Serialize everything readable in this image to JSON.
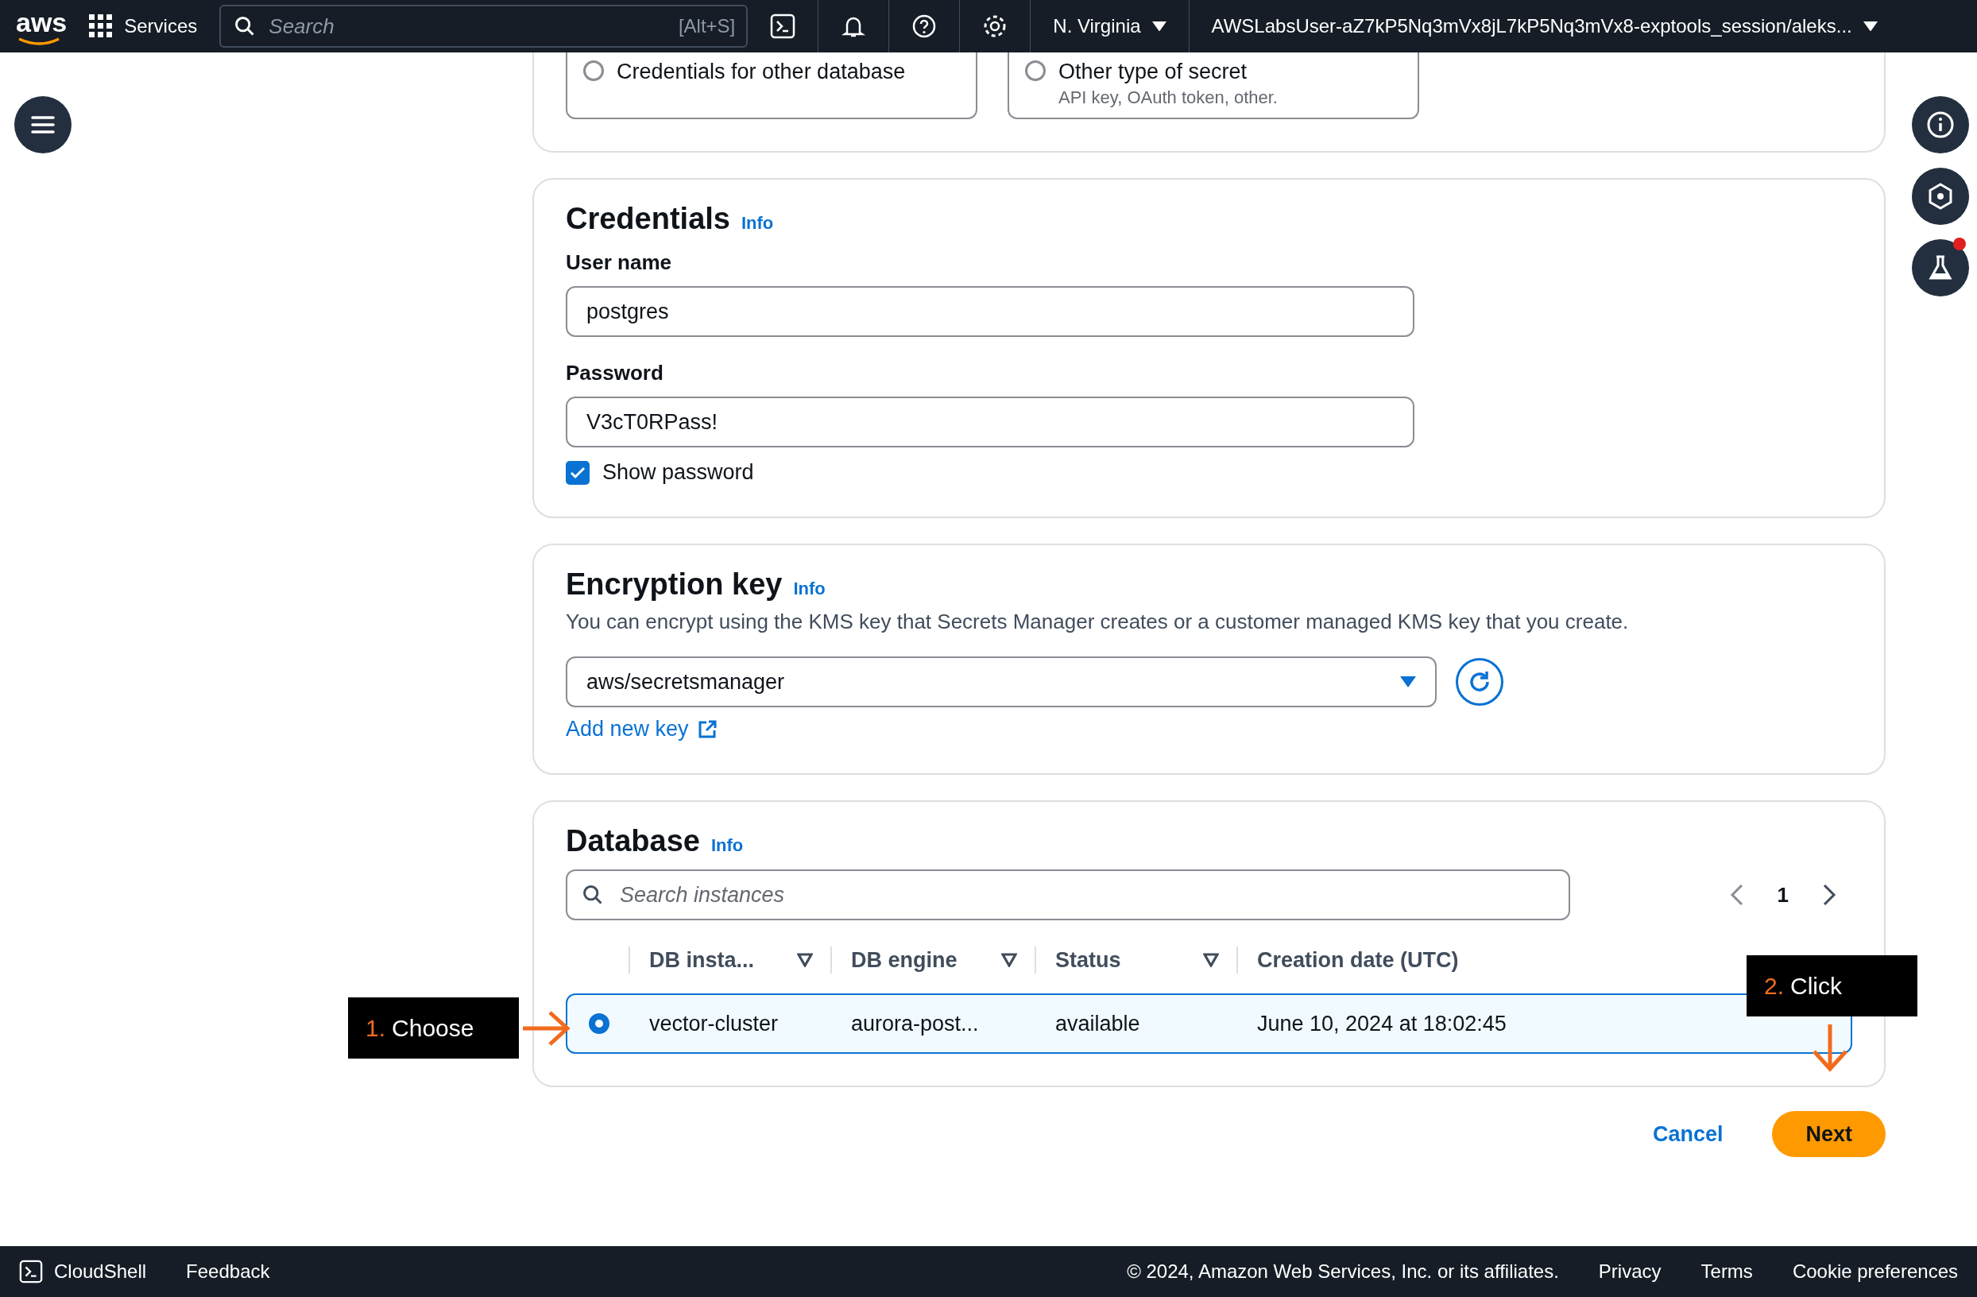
{
  "top_nav": {
    "logo": "aws",
    "services": "Services",
    "search": {
      "placeholder": "Search",
      "shortcut": "[Alt+S]"
    },
    "region": "N. Virginia",
    "account": "AWSLabsUser-aZ7kP5Nq3mVx8jL7kP5Nq3mVx8-exptools_session/aleks..."
  },
  "secret_types": [
    {
      "label": "Credentials for other database",
      "selected": false
    },
    {
      "label": "Other type of secret",
      "description": "API key, OAuth token, other.",
      "selected": false
    }
  ],
  "credentials": {
    "title": "Credentials",
    "info": "Info",
    "username": {
      "label": "User name",
      "value": "postgres"
    },
    "password": {
      "label": "Password",
      "value": "V3cT0RPass!"
    },
    "show_password": {
      "label": "Show password",
      "checked": true
    }
  },
  "encryption": {
    "title": "Encryption key",
    "info": "Info",
    "description": "You can encrypt using the KMS key that Secrets Manager creates or a customer managed KMS key that you create.",
    "key": "aws/secretsmanager",
    "add_key": "Add new key"
  },
  "database": {
    "title": "Database",
    "info": "Info",
    "search": {
      "placeholder": "Search instances"
    },
    "page": "1",
    "columns": [
      {
        "label": "DB insta...",
        "sortable": true
      },
      {
        "label": "DB engine",
        "sortable": true
      },
      {
        "label": "Status",
        "sortable": true
      },
      {
        "label": "Creation date (UTC)",
        "sortable": false
      }
    ],
    "rows": [
      {
        "cells": [
          "vector-cluster",
          "aurora-post...",
          "available",
          "June 10, 2024 at 18:02:45"
        ],
        "selected": true
      }
    ]
  },
  "actions": [
    {
      "label": "Cancel",
      "kind": "link"
    },
    {
      "label": "Next",
      "kind": "primary"
    }
  ],
  "annotations": [
    {
      "number": "1.",
      "label": "Choose"
    },
    {
      "number": "2.",
      "label": "Click"
    }
  ],
  "footer": {
    "cloudshell": "CloudShell",
    "feedback": "Feedback",
    "copyright": "© 2024, Amazon Web Services, Inc. or its affiliates.",
    "links": [
      "Privacy",
      "Terms",
      "Cookie preferences"
    ]
  }
}
